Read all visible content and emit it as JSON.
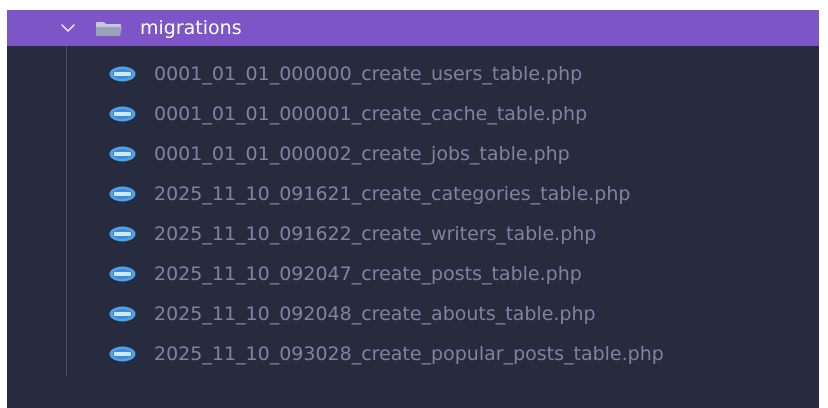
{
  "folder": {
    "name": "migrations",
    "expanded": true,
    "highlight_color": "#7d55c7",
    "icons": {
      "toggle": "chevron-down-icon",
      "folder": "folder-open-icon"
    }
  },
  "files": [
    {
      "name": "0001_01_01_000000_create_users_table.php",
      "icon": "php-file-icon"
    },
    {
      "name": "0001_01_01_000001_create_cache_table.php",
      "icon": "php-file-icon"
    },
    {
      "name": "0001_01_01_000002_create_jobs_table.php",
      "icon": "php-file-icon"
    },
    {
      "name": "2025_11_10_091621_create_categories_table.php",
      "icon": "php-file-icon"
    },
    {
      "name": "2025_11_10_091622_create_writers_table.php",
      "icon": "php-file-icon"
    },
    {
      "name": "2025_11_10_092047_create_posts_table.php",
      "icon": "php-file-icon"
    },
    {
      "name": "2025_11_10_092048_create_abouts_table.php",
      "icon": "php-file-icon"
    },
    {
      "name": "2025_11_10_093028_create_popular_posts_table.php",
      "icon": "php-file-icon"
    }
  ],
  "colors": {
    "panel_background": "#262c3e",
    "file_text": "#7c84a0",
    "php_icon": "#4fa3e8"
  }
}
